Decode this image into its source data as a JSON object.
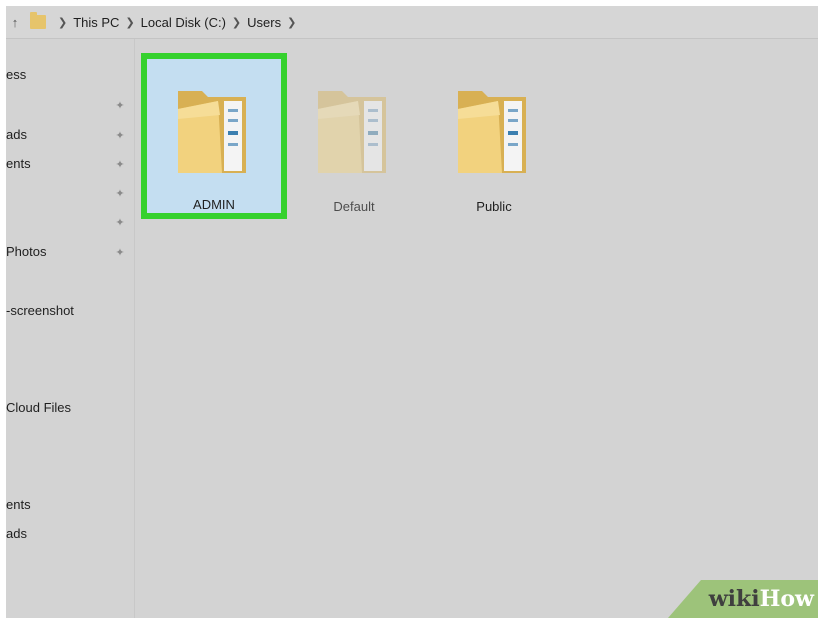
{
  "address_bar": {
    "crumbs": [
      "This PC",
      "Local Disk (C:)",
      "Users"
    ]
  },
  "nav_pane": {
    "items": [
      {
        "label": "ess"
      },
      {
        "label": ""
      },
      {
        "label": "ads"
      },
      {
        "label": "ents"
      },
      {
        "label": ""
      },
      {
        "label": ""
      },
      {
        "label": "Photos"
      },
      {
        "label": "-screenshot"
      },
      {
        "label": "Cloud Files"
      },
      {
        "label": "ents"
      },
      {
        "label": "ads"
      }
    ]
  },
  "content": {
    "folders": [
      {
        "name": "ADMIN",
        "selected": true
      },
      {
        "name": "Default",
        "selected": false
      },
      {
        "name": "Public",
        "selected": false
      }
    ]
  },
  "watermark": {
    "wiki": "wiki",
    "how": "How"
  },
  "colors": {
    "highlight_border": "#35d12d",
    "selection_fill": "#c4def1",
    "folder": "#e6c46b",
    "watermark_bg": "#9dc37a"
  }
}
